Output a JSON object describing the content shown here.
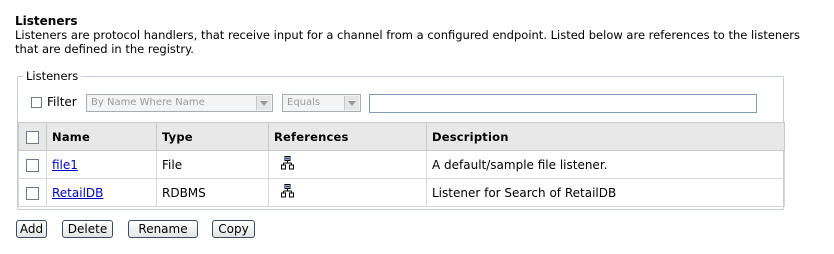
{
  "header": {
    "title": "Listeners",
    "description": "Listeners are protocol handlers, that receive input for a channel from a configured endpoint. Listed below are references to the listeners that are defined in the registry."
  },
  "panel": {
    "legend": "Listeners",
    "filter": {
      "label": "Filter",
      "field_value": "By Name Where Name",
      "operator_value": "Equals",
      "text_value": ""
    },
    "table": {
      "columns": [
        "Name",
        "Type",
        "References",
        "Description"
      ],
      "rows": [
        {
          "name": "file1",
          "type": "File",
          "description": "A default/sample file listener."
        },
        {
          "name": "RetailDB",
          "type": "RDBMS",
          "description": "Listener for Search of RetailDB"
        }
      ]
    }
  },
  "actions": {
    "add": "Add",
    "delete": "Delete",
    "rename": "Rename",
    "copy": "Copy"
  },
  "icons": {
    "references": "hierarchy-icon"
  }
}
